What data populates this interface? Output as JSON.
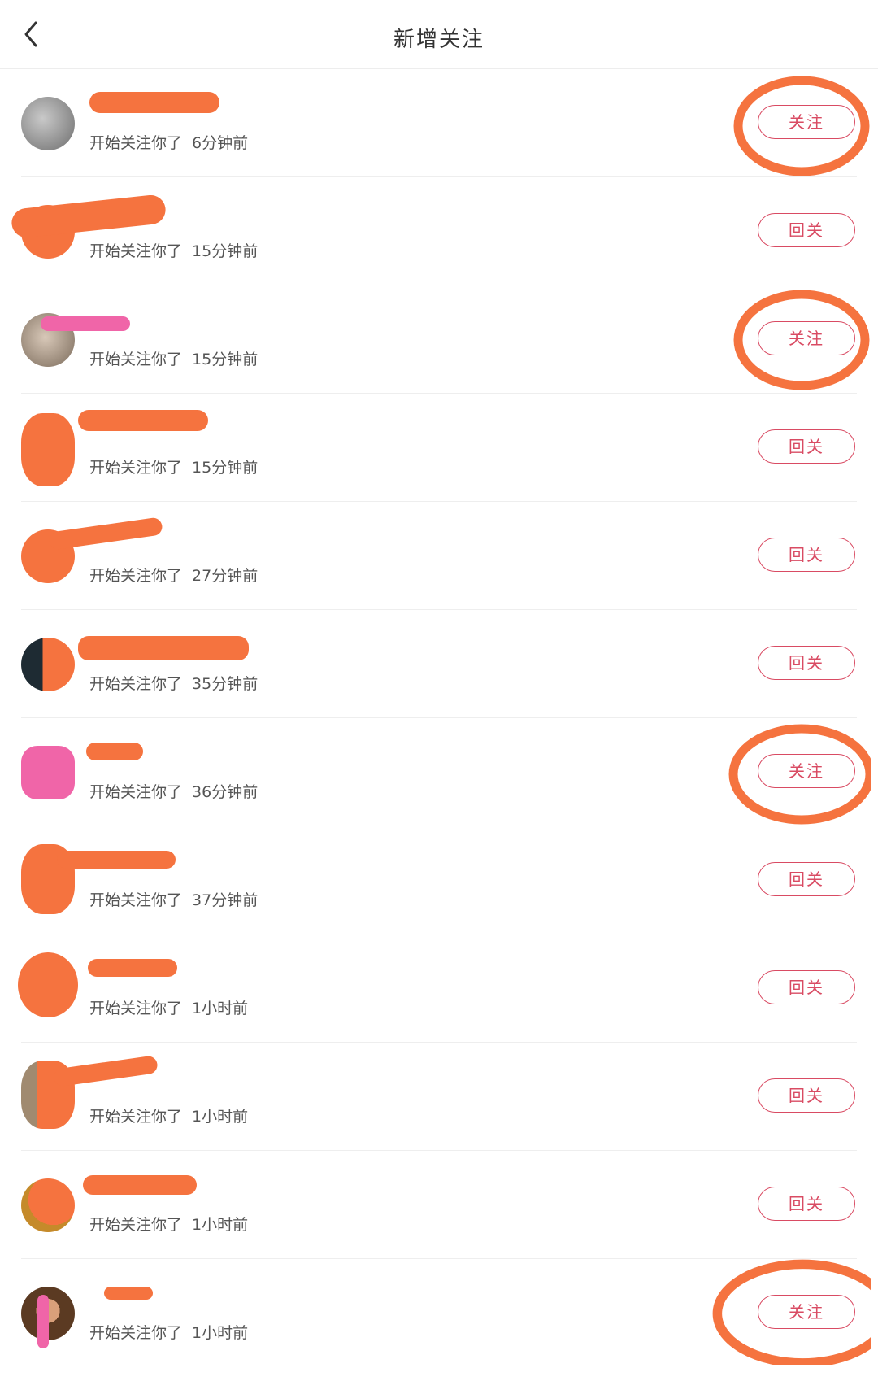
{
  "header": {
    "title": "新增关注",
    "back_icon": "chevron-left-icon"
  },
  "colors": {
    "accent": "#d94b63",
    "redaction": "#f5733f",
    "redaction_pink": "#f065a8"
  },
  "follow_text": "开始关注你了",
  "rows": [
    {
      "time": "6分钟前",
      "button": "关注",
      "circled": true
    },
    {
      "time": "15分钟前",
      "button": "回关",
      "circled": false
    },
    {
      "time": "15分钟前",
      "button": "关注",
      "circled": true
    },
    {
      "time": "15分钟前",
      "button": "回关",
      "circled": false
    },
    {
      "time": "27分钟前",
      "button": "回关",
      "circled": false
    },
    {
      "time": "35分钟前",
      "button": "回关",
      "circled": false
    },
    {
      "time": "36分钟前",
      "button": "关注",
      "circled": true
    },
    {
      "time": "37分钟前",
      "button": "回关",
      "circled": false
    },
    {
      "time": "1小时前",
      "button": "回关",
      "circled": false
    },
    {
      "time": "1小时前",
      "button": "回关",
      "circled": false
    },
    {
      "time": "1小时前",
      "button": "回关",
      "circled": false
    },
    {
      "time": "1小时前",
      "button": "关注",
      "circled": true
    }
  ]
}
